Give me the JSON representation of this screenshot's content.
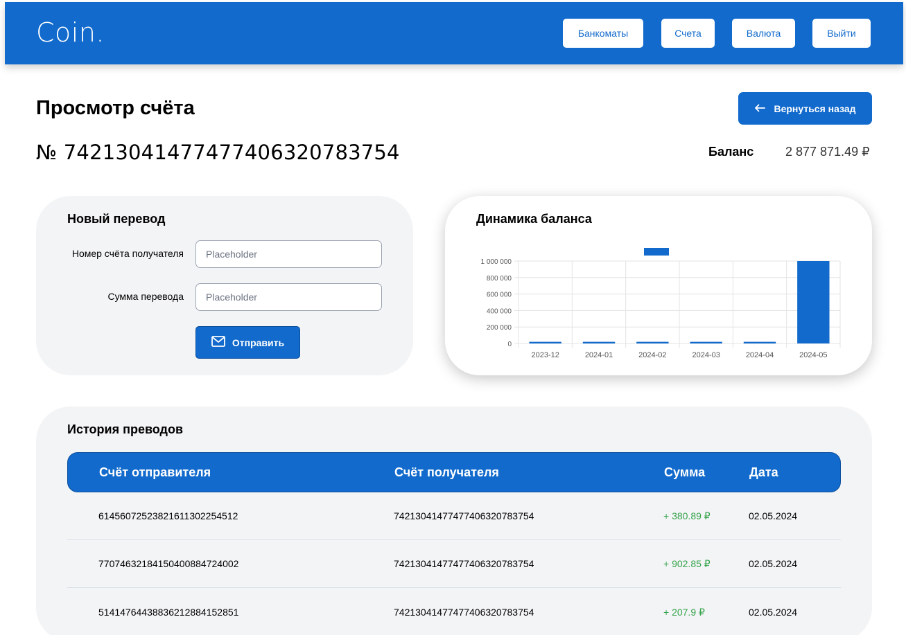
{
  "header": {
    "logo": "Coin.",
    "nav": [
      {
        "label": "Банкоматы"
      },
      {
        "label": "Счета"
      },
      {
        "label": "Валюта"
      },
      {
        "label": "Выйти"
      }
    ]
  },
  "page": {
    "title": "Просмотр счёта",
    "back_label": "Вернуться назад",
    "account_number": "№ 74213041477477406320783754",
    "balance_label": "Баланс",
    "balance_value": "2 877 871.49 ₽"
  },
  "transfer": {
    "title": "Новый перевод",
    "recipient_label": "Номер счёта получателя",
    "recipient_placeholder": "Placeholder",
    "amount_label": "Сумма перевода",
    "amount_placeholder": "Placeholder",
    "send_label": "Отправить"
  },
  "chart_data": {
    "type": "bar",
    "title": "Динамика баланса",
    "categories": [
      "2023-12",
      "2024-01",
      "2024-02",
      "2024-03",
      "2024-04",
      "2024-05"
    ],
    "values": [
      20000,
      20000,
      20000,
      20000,
      20000,
      1000000
    ],
    "ylim": [
      0,
      1000000
    ],
    "yticks": [
      "0",
      "200 000",
      "400 000",
      "600 000",
      "800 000",
      "1 000 000"
    ],
    "ytick_values": [
      0,
      200000,
      400000,
      600000,
      800000,
      1000000
    ],
    "legend": "top",
    "grid": true,
    "color": "#116acc"
  },
  "history": {
    "title": "История преводов",
    "columns": [
      "Счёт отправителя",
      "Счёт получателя",
      "Сумма",
      "Дата"
    ],
    "rows": [
      {
        "from": "61456072523821611302254512",
        "to": "74213041477477406320783754",
        "amount": "+ 380.89 ₽",
        "date": "02.05.2024"
      },
      {
        "from": "77074632184150400884724002",
        "to": "74213041477477406320783754",
        "amount": "+ 902.85 ₽",
        "date": "02.05.2024"
      },
      {
        "from": "51414764438836212884152851",
        "to": "74213041477477406320783754",
        "amount": "+ 207.9 ₽",
        "date": "02.05.2024"
      }
    ]
  },
  "colors": {
    "accent": "#116acc",
    "card_bg": "#f3f4f6",
    "positive": "#34a34a"
  },
  "icons": {
    "back": "arrow-left-icon",
    "send": "mail-icon"
  }
}
